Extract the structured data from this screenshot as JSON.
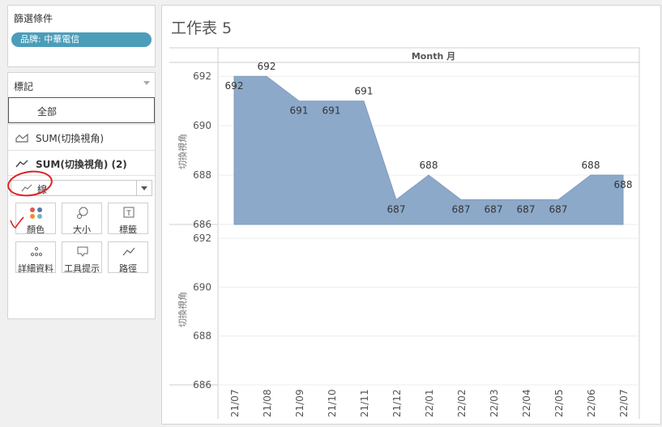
{
  "filters": {
    "title": "篩選條件",
    "pill": "品牌: 中華電信"
  },
  "marks": {
    "title": "標記",
    "tabs": [
      "全部",
      "SUM(切換視角)",
      "SUM(切換視角) (2)"
    ],
    "mark_type": "線",
    "properties": [
      "顏色",
      "大小",
      "標籤",
      "詳細資料",
      "工具提示",
      "路徑"
    ]
  },
  "sheet": {
    "title": "工作表 5",
    "header": "Month 月"
  },
  "axis": {
    "ylabel": "切換視角"
  },
  "colors": {
    "area": "#8da9c9",
    "pill": "#4b9dba",
    "annotation": "#e02020"
  },
  "chart_data": [
    {
      "type": "area",
      "categories": [
        "21/07",
        "21/08",
        "21/09",
        "21/10",
        "21/11",
        "21/12",
        "22/01",
        "22/02",
        "22/03",
        "22/04",
        "22/05",
        "22/06",
        "22/07"
      ],
      "values": [
        692,
        692,
        691,
        691,
        691,
        687,
        688,
        687,
        687,
        687,
        687,
        688,
        688
      ],
      "ylabel": "切換視角",
      "yticks": [
        686,
        688,
        690,
        692
      ],
      "ylim": [
        686,
        692.5
      ],
      "labels": true
    },
    {
      "type": "line",
      "categories": [
        "21/07",
        "21/08",
        "21/09",
        "21/10",
        "21/11",
        "21/12",
        "22/01",
        "22/02",
        "22/03",
        "22/04",
        "22/05",
        "22/06",
        "22/07"
      ],
      "values": [],
      "ylabel": "切換視角",
      "yticks": [
        686,
        688,
        690,
        692
      ],
      "ylim": [
        686,
        692.5
      ]
    }
  ]
}
